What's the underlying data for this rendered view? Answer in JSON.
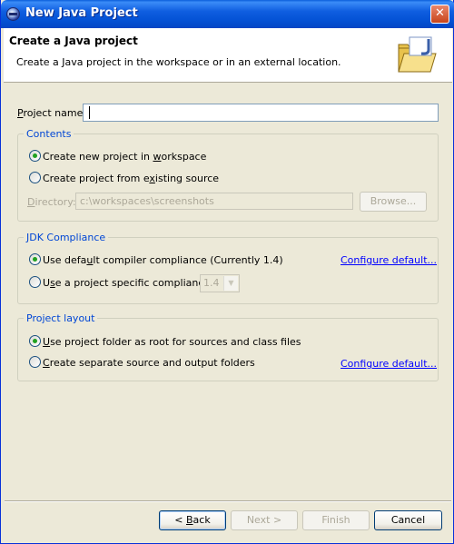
{
  "window": {
    "title": "New Java Project",
    "close_glyph": "✕"
  },
  "header": {
    "title": "Create a Java project",
    "description": "Create a Java project in the workspace or in an external location.",
    "icon": "java-folder-wizard-icon"
  },
  "project_name": {
    "label_mnemonic": "P",
    "label_rest": "roject name:",
    "value": ""
  },
  "contents": {
    "legend": "Contents",
    "option_new": {
      "pre": "Create new project in ",
      "mnemonic": "w",
      "post": "orkspace",
      "selected": true
    },
    "option_existing": {
      "pre": "Create project from e",
      "mnemonic": "x",
      "post": "isting source",
      "selected": false
    },
    "directory": {
      "label_mnemonic": "D",
      "label_rest": "irectory:",
      "value": "c:\\workspaces\\screenshots"
    },
    "browse_label": "Browse..."
  },
  "jdk": {
    "legend": "JDK Compliance",
    "option_default": {
      "pre": "Use defa",
      "mnemonic": "u",
      "post": "lt compiler compliance (Currently 1.4)",
      "selected": true
    },
    "option_specific": {
      "pre": "U",
      "mnemonic": "s",
      "post": "e a project specific compliance:",
      "selected": false
    },
    "version": "1.4",
    "configure_link": "Configure default..."
  },
  "layout": {
    "legend": "Project layout",
    "option_root": {
      "pre": "",
      "mnemonic": "U",
      "post": "se project folder as root for sources and class files",
      "selected": true
    },
    "option_separate": {
      "pre": "",
      "mnemonic": "C",
      "post": "reate separate source and output folders",
      "selected": false
    },
    "configure_link": "Configure default..."
  },
  "footer": {
    "back_pre": "< ",
    "back_mnemonic": "B",
    "back_post": "ack",
    "next_label": "Next >",
    "finish_label": "Finish",
    "cancel_label": "Cancel"
  },
  "colors": {
    "accent": "#0046d5",
    "title_bar": "#0553d6",
    "dialog_bg": "#ece9d8",
    "link": "#0000ff"
  }
}
